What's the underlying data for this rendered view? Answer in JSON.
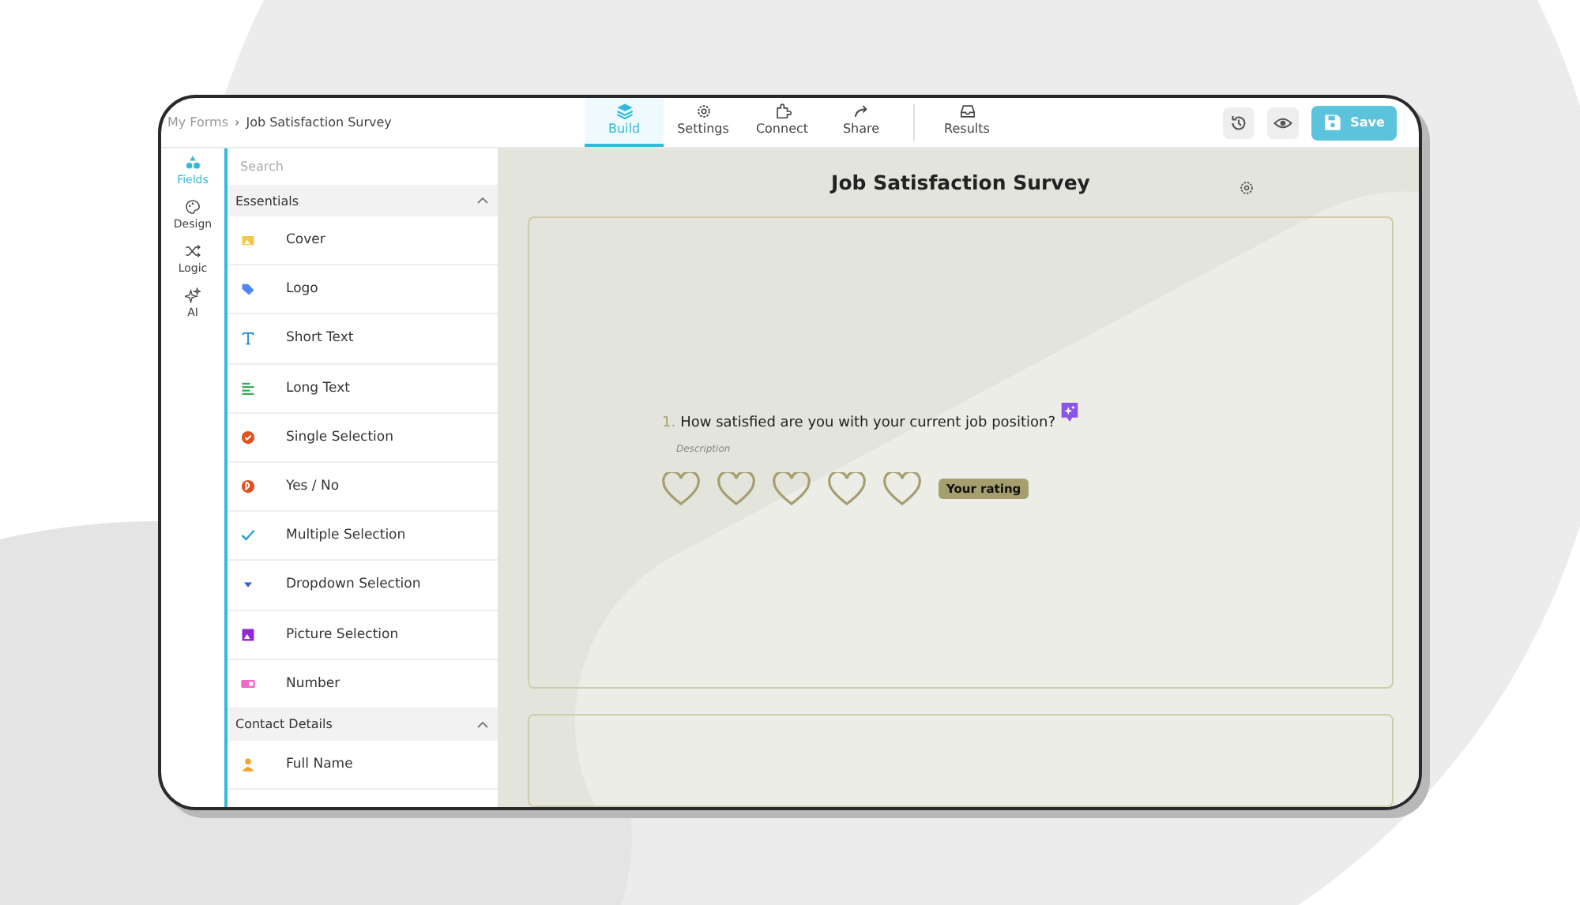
{
  "breadcrumb": {
    "parent": "My Forms",
    "separator": "›",
    "current": "Job Satisfaction Survey"
  },
  "tabs": [
    {
      "label": "Build",
      "selected": true
    },
    {
      "label": "Settings",
      "selected": false
    },
    {
      "label": "Connect",
      "selected": false
    },
    {
      "label": "Share",
      "selected": false
    },
    {
      "label": "Results",
      "selected": false
    }
  ],
  "save_button": {
    "label": "Save"
  },
  "rail": [
    {
      "label": "Fields",
      "selected": true
    },
    {
      "label": "Design",
      "selected": false
    },
    {
      "label": "Logic",
      "selected": false
    },
    {
      "label": "AI",
      "selected": false
    }
  ],
  "search": {
    "placeholder": "Search"
  },
  "sections": [
    {
      "title": "Essentials",
      "expanded": true,
      "items": [
        {
          "label": "Cover",
          "kind": "cover"
        },
        {
          "label": "Logo",
          "kind": "logo"
        },
        {
          "label": "Short Text",
          "kind": "short"
        },
        {
          "label": "Long Text",
          "kind": "long"
        },
        {
          "label": "Single Selection",
          "kind": "single"
        },
        {
          "label": "Yes / No",
          "kind": "yesno"
        },
        {
          "label": "Multiple Selection",
          "kind": "multiple"
        },
        {
          "label": "Dropdown Selection",
          "kind": "dropdown"
        },
        {
          "label": "Picture Selection",
          "kind": "picture"
        },
        {
          "label": "Number",
          "kind": "number"
        }
      ]
    },
    {
      "title": "Contact Details",
      "expanded": true,
      "items": [
        {
          "label": "Full Name",
          "kind": "person"
        }
      ]
    }
  ],
  "form": {
    "title": "Job Satisfaction Survey",
    "question": {
      "number": "1.",
      "text": "How satisfied are you with your current job position?",
      "description": "Description",
      "stars": 0,
      "rating_label": "Your rating"
    }
  }
}
